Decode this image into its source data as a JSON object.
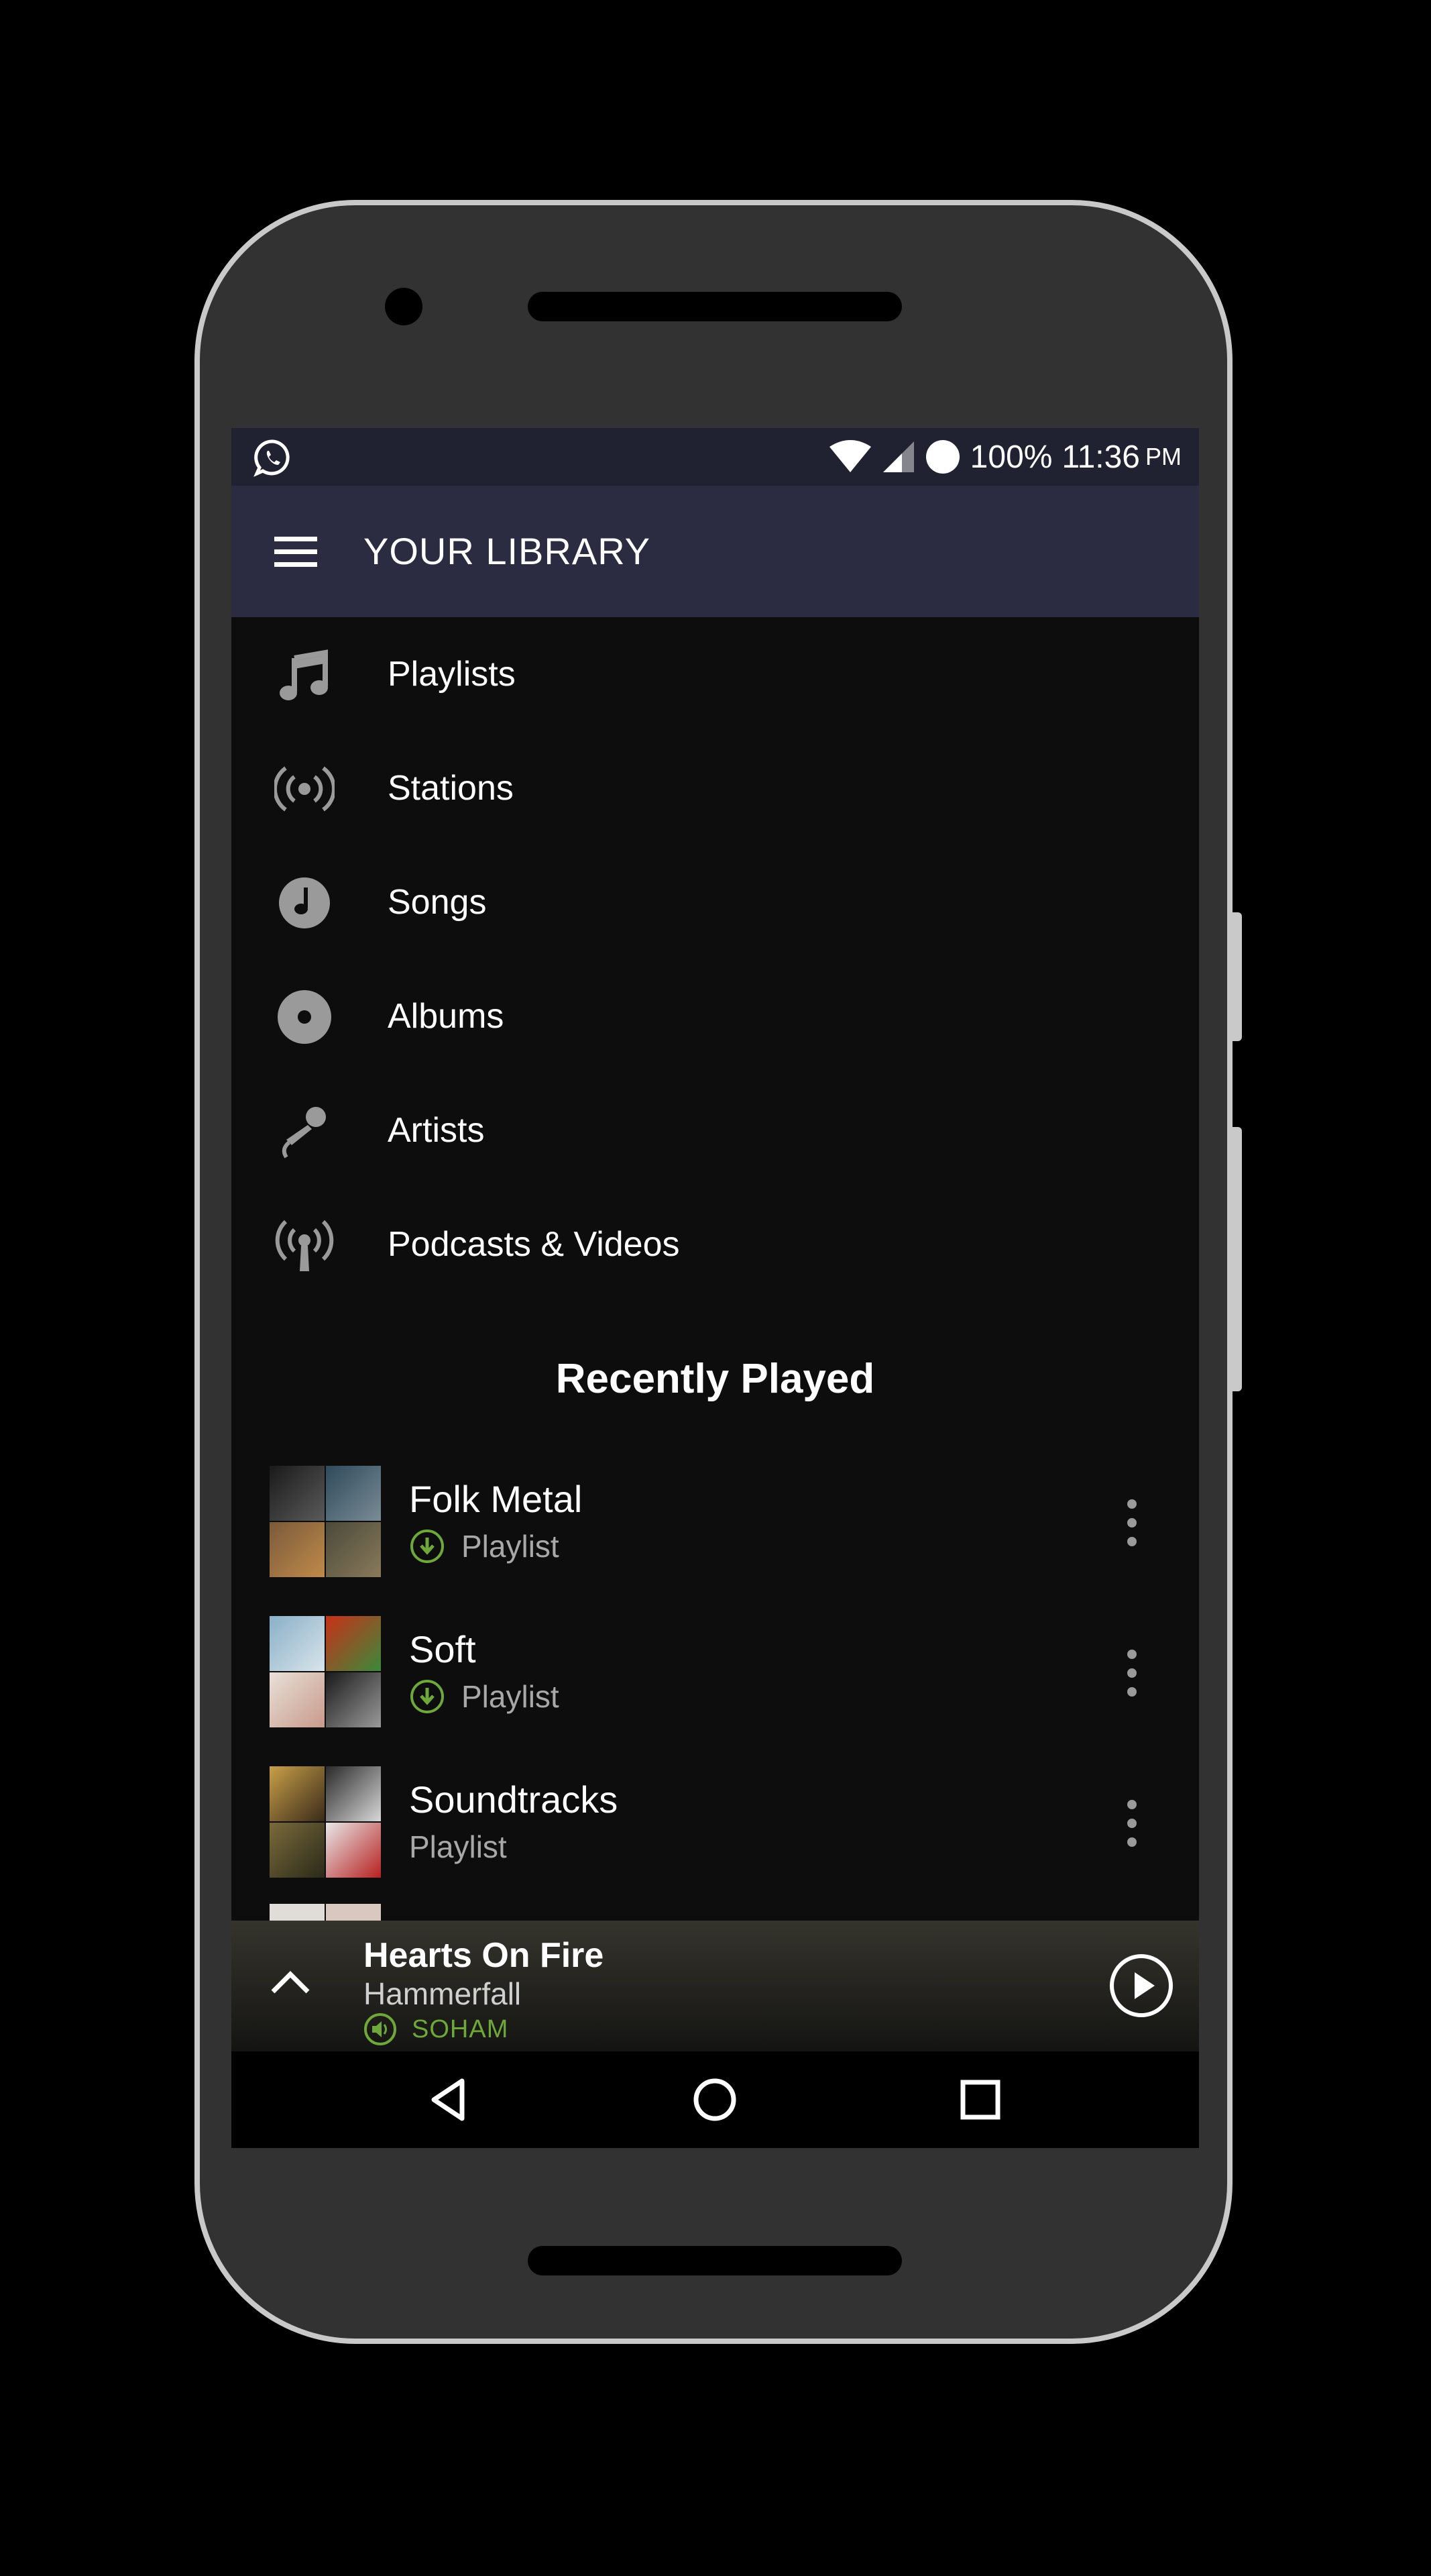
{
  "status_bar": {
    "notification_icon": "whatsapp-icon",
    "battery": "100%",
    "time": "11:36",
    "ampm": "PM"
  },
  "toolbar": {
    "title": "YOUR LIBRARY",
    "menu_icon": "hamburger-menu-icon"
  },
  "library_nav": [
    {
      "label": "Playlists",
      "icon": "music-note-icon"
    },
    {
      "label": "Stations",
      "icon": "radio-station-icon"
    },
    {
      "label": "Songs",
      "icon": "song-disc-icon"
    },
    {
      "label": "Albums",
      "icon": "album-disc-icon"
    },
    {
      "label": "Artists",
      "icon": "microphone-icon"
    },
    {
      "label": "Podcasts & Videos",
      "icon": "podcast-icon"
    }
  ],
  "recently_played": {
    "title": "Recently Played",
    "items": [
      {
        "name": "Folk Metal",
        "type": "Playlist",
        "downloaded": true
      },
      {
        "name": "Soft",
        "type": "Playlist",
        "downloaded": true
      },
      {
        "name": "Soundtracks",
        "type": "Playlist",
        "downloaded": false
      }
    ]
  },
  "now_playing": {
    "track": "Hearts On Fire",
    "artist": "Hammerfall",
    "device": "SOHAM",
    "accent_color": "#6fa83a"
  },
  "colors": {
    "status_bar_bg": "#202231",
    "toolbar_bg": "#2b2b41",
    "content_bg": "#0d0d0d"
  }
}
